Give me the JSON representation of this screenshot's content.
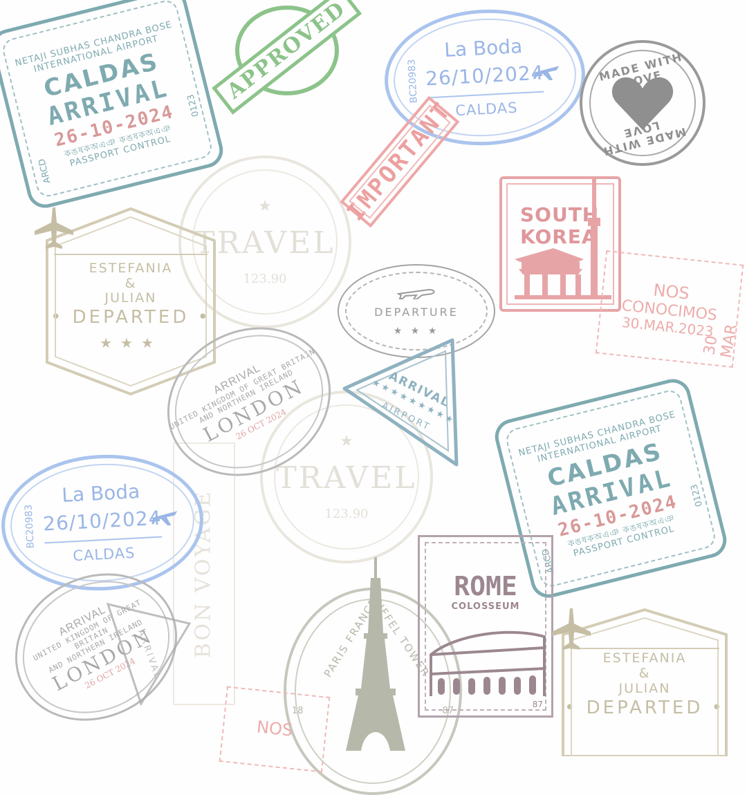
{
  "caldas": {
    "top": "NETAJI SUBHAS CHANDRA BOSE",
    "top2": "INTERNATIONAL AIRPORT",
    "city": "CALDAS",
    "arrival": "ARRIVAL",
    "date": "26-10-2024",
    "script": "কঙষকঅএঞ কঙষকঅএঞ",
    "bottom": "PASSPORT CONTROL",
    "side_left": "ARCD",
    "side_right": "0123"
  },
  "approved": {
    "label": "APPROVED"
  },
  "boda": {
    "title": "La Boda",
    "date": "26/10/2024",
    "place": "CALDAS",
    "code": "BC20983"
  },
  "love": {
    "top": "MADE WITH LOVE",
    "bottom": "MADE WITH LOVE"
  },
  "important": {
    "label": "IMPORTANT"
  },
  "korea": {
    "line1": "SOUTH",
    "line2": "KOREA"
  },
  "nos": {
    "line1": "NOS",
    "line2": "CONOCIMOS",
    "line3": "30.MAR.2023",
    "side": "30 MAR"
  },
  "travel": {
    "label": "TRAVEL",
    "number": "123.90",
    "star": "★"
  },
  "hex": {
    "name1": "ESTEFANIA",
    "amp": "&",
    "name2": "JULIAN",
    "status": "• DEPARTED •",
    "stars": "★★★"
  },
  "departure": {
    "label": "DEPARTURE",
    "stars": "★ ★ ★"
  },
  "triangle": {
    "label": "ARRIVAL",
    "stars": "★★★★★★★★★",
    "sub": "AIRPORT"
  },
  "london": {
    "arrival": "ARRIVAL",
    "line1": "UNITED KINGDOM OF GREAT BRITAIN",
    "line2": "AND NORTHERN IRELAND",
    "city": "LONDON",
    "date": "26 OCT 2024"
  },
  "bon": {
    "label": "BON VOYAGE"
  },
  "rome": {
    "title": "ROME",
    "subtitle": "COLOSSEUM",
    "number": "87"
  },
  "paris": {
    "left": "PARIS FRANCE",
    "right": "EIFFEL TOWER",
    "num_left": "18",
    "num_right": "87"
  },
  "colors": {
    "teal": "#7eaab0",
    "green": "#8cc38a",
    "blue": "#aac4ee",
    "gray": "#9a9a9a",
    "pink": "#eca0a0",
    "beige": "#c5bea4",
    "mauve": "#9c8790"
  }
}
